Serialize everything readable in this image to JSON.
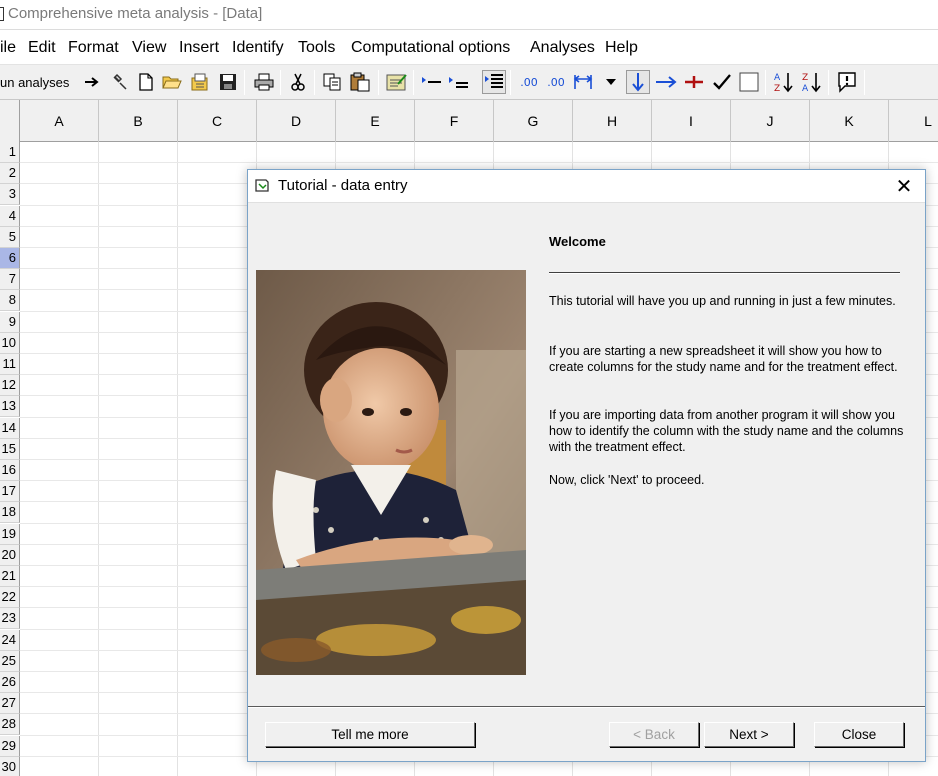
{
  "window": {
    "title": "Comprehensive meta analysis - [Data]"
  },
  "menu": {
    "items": [
      {
        "label": "File",
        "visible": "ile"
      },
      {
        "label": "Edit"
      },
      {
        "label": "Format"
      },
      {
        "label": "View"
      },
      {
        "label": "Insert"
      },
      {
        "label": "Identify"
      },
      {
        "label": "Tools"
      },
      {
        "label": "Computational options"
      },
      {
        "label": "Analyses"
      },
      {
        "label": "Help"
      }
    ]
  },
  "toolbar": {
    "run_label": "Run analyses",
    "run_label_visible": "un analyses",
    "icons": [
      "arrow-right-icon",
      "hammer-icon",
      "new-file-icon",
      "open-folder-icon",
      "import-icon",
      "save-icon",
      "print-icon",
      "cut-icon",
      "copy-icon",
      "paste-icon",
      "edit-icon",
      "indent-left-icon",
      "indent-right-icon",
      "list-icon",
      "increase-decimals-icon",
      "decrease-decimals-icon",
      "column-width-icon",
      "dropdown-icon",
      "arrow-down-icon",
      "arrow-right-blue-icon",
      "plus-icon",
      "check-icon",
      "checkbox-icon",
      "sort-az-icon",
      "sort-za-icon",
      "info-icon"
    ]
  },
  "sheet": {
    "columns": [
      "A",
      "B",
      "C",
      "D",
      "E",
      "F",
      "G",
      "H",
      "I",
      "J",
      "K",
      "L"
    ],
    "rows": [
      "1",
      "2",
      "3",
      "4",
      "5",
      "6",
      "7",
      "8",
      "9",
      "10",
      "11",
      "12",
      "13",
      "14",
      "15",
      "16",
      "17",
      "18",
      "19",
      "20",
      "21",
      "22",
      "23",
      "24",
      "25",
      "26",
      "27",
      "28",
      "29",
      "30"
    ],
    "active_row": "6"
  },
  "dialog": {
    "title": "Tutorial - data entry",
    "heading": "Welcome",
    "paragraphs": [
      "This tutorial will have you up and running in just a few minutes.",
      "If you are starting a new spreadsheet it will show you how to create columns for the study name and for the treatment effect.",
      "If you are importing data from another program it will show you how to identify the column with the study name and the columns with the treatment effect.",
      "Now, click 'Next' to proceed."
    ],
    "buttons": {
      "tell_more": "Tell me more",
      "back": "< Back",
      "next": "Next >",
      "close": "Close"
    }
  },
  "colors": {
    "active_row_header": "#aab7e6",
    "dialog_border": "#7aa3c8",
    "arrow_blue": "#1a4fd6",
    "plus_red": "#b01010"
  }
}
